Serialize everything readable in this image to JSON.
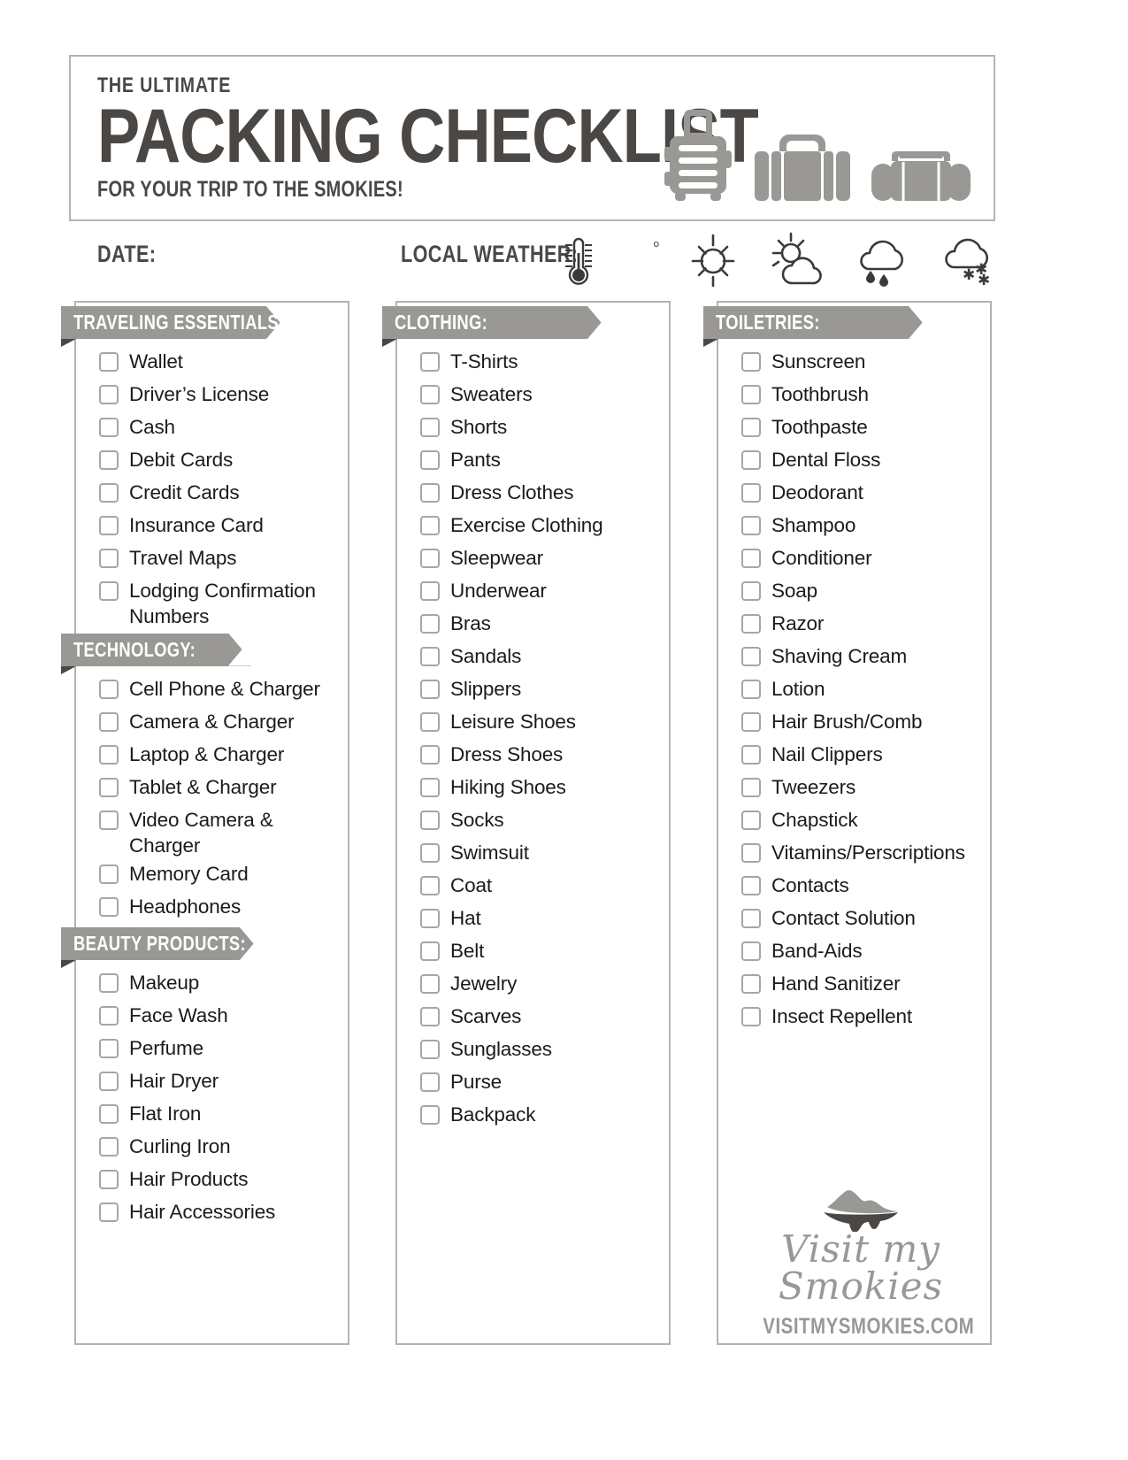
{
  "header": {
    "kicker": "THE ULTIMATE",
    "title": "PACKING CHECKLIST",
    "subtitle": "FOR YOUR TRIP TO THE SMOKIES!",
    "icons": [
      "rolling-suitcase-icon",
      "hard-suitcase-icon",
      "duffel-bag-icon"
    ]
  },
  "info_row": {
    "date_label": "DATE:",
    "date_value": "",
    "weather_label": "LOCAL WEATHER:",
    "temperature_value": "",
    "degree_symbol": "°",
    "weather_icons": [
      "thermometer-icon",
      "sunny-icon",
      "partly-cloudy-icon",
      "rainy-icon",
      "snowy-icon"
    ]
  },
  "columns": [
    {
      "id": "column-left",
      "sections": [
        {
          "title": "TRAVELING ESSENTIALS:",
          "items": [
            "Wallet",
            "Driver’s License",
            "Cash",
            "Debit Cards",
            "Credit Cards",
            "Insurance Card",
            "Travel Maps",
            "Lodging Confirmation Numbers"
          ]
        },
        {
          "title": "TECHNOLOGY:",
          "items": [
            "Cell Phone & Charger",
            "Camera & Charger",
            "Laptop & Charger",
            "Tablet & Charger",
            "Video Camera & Charger",
            "Memory Card",
            "Headphones"
          ]
        },
        {
          "title": "BEAUTY PRODUCTS:",
          "items": [
            "Makeup",
            "Face Wash",
            "Perfume",
            "Hair Dryer",
            "Flat Iron",
            "Curling Iron",
            "Hair Products",
            "Hair Accessories"
          ]
        }
      ]
    },
    {
      "id": "column-middle",
      "sections": [
        {
          "title": "CLOTHING:",
          "items": [
            "T-Shirts",
            "Sweaters",
            "Shorts",
            "Pants",
            "Dress Clothes",
            "Exercise Clothing",
            "Sleepwear",
            "Underwear",
            "Bras",
            "Sandals",
            "Slippers",
            "Leisure Shoes",
            "Dress Shoes",
            "Hiking Shoes",
            "Socks",
            "Swimsuit",
            "Coat",
            "Hat",
            "Belt",
            "Jewelry",
            "Scarves",
            "Sunglasses",
            "Purse",
            "Backpack"
          ]
        }
      ]
    },
    {
      "id": "column-right",
      "sections": [
        {
          "title": "TOILETRIES:",
          "items": [
            "Sunscreen",
            "Toothbrush",
            "Toothpaste",
            "Dental Floss",
            "Deodorant",
            "Shampoo",
            "Conditioner",
            "Soap",
            "Razor",
            "Shaving Cream",
            "Lotion",
            "Hair Brush/Comb",
            "Nail Clippers",
            "Tweezers",
            "Chapstick",
            "Vitamins/Perscriptions",
            "Contacts",
            "Contact Solution",
            "Band-Aids",
            "Hand Sanitizer",
            "Insect Repellent"
          ]
        }
      ]
    }
  ],
  "logo": {
    "script_text": "Visit my Smokies",
    "url_text": "VISITMYSMOKIES.COM",
    "mark": "smoky-mountain-icon"
  },
  "colors": {
    "banner_gray": "#9a9894",
    "text_dark": "#4a4745",
    "border_gray": "#b3b3b3",
    "checkbox_border": "#a8a6a3"
  }
}
